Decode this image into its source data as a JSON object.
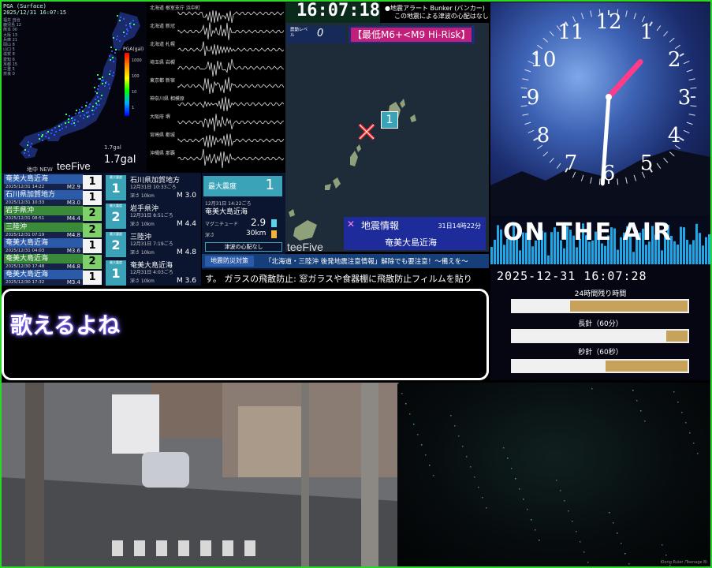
{
  "pga_panel": {
    "title": "PGA (Surface)",
    "datetime": "2025/12/31 16:07:15",
    "prefectures": [
      "福井 自治",
      "鹿児島 12",
      "熊本 00",
      "大阪 13",
      "兵庫 21",
      "岡山 8",
      "山口 5",
      "滋賀 8",
      "愛知 6",
      "京都 15",
      "三重 5",
      "奈良 0"
    ],
    "scale_title": "PGA(gal)",
    "scale_ticks": [
      "1000",
      "100",
      "10",
      "1"
    ],
    "gal_label": "1.7gal",
    "gal_prefix": "1.7gal",
    "footer_left": "地中 NEW",
    "logo": "teeFive"
  },
  "waveforms": {
    "stations": [
      "北海道 根室支庁 浜中町",
      "北海道 新冠",
      "北海道 札幌",
      "埼玉県 岩槻",
      "東京都 新宿",
      "神奈川県 相模原",
      "大阪府 堺",
      "宮崎県 都城",
      "沖縄県 那覇"
    ]
  },
  "quake_list": [
    {
      "loc": "奄美大島近海",
      "time": "2025/12/31 14:22",
      "mag": "M2.9",
      "int": "1",
      "color": "#f4f4f4"
    },
    {
      "loc": "石川県加賀地方",
      "time": "2025/12/31 10:33",
      "mag": "M3.0",
      "int": "1",
      "color": "#f4f4f4"
    },
    {
      "loc": "岩手県沖",
      "time": "2025/12/31 08:51",
      "mag": "M4.4",
      "int": "2",
      "color": "#7fd06a"
    },
    {
      "loc": "三陸沖",
      "time": "2025/12/31 07:19",
      "mag": "M4.8",
      "int": "2",
      "color": "#7fd06a"
    },
    {
      "loc": "奄美大島近海",
      "time": "2025/12/31 04:03",
      "mag": "M3.6",
      "int": "1",
      "color": "#f4f4f4"
    },
    {
      "loc": "奄美大島近海",
      "time": "2025/12/30 17:48",
      "mag": "M4.8",
      "int": "2",
      "color": "#7fd06a"
    },
    {
      "loc": "奄美大島近海",
      "time": "2025/12/30 17:32",
      "mag": "M3.4",
      "int": "1",
      "color": "#f4f4f4"
    }
  ],
  "quake_detail": [
    {
      "badge_label": "最大震度",
      "int": "1",
      "name": "石川県加賀地方",
      "time": "12月31日 10:33ごろ",
      "depth": "深さ 10km",
      "mag": "M 3.0"
    },
    {
      "badge_label": "最大震度",
      "int": "2",
      "name": "岩手県沖",
      "time": "12月31日 8:51ごろ",
      "depth": "深さ 10km",
      "mag": "M 4.4"
    },
    {
      "badge_label": "最大震度",
      "int": "2",
      "name": "三陸沖",
      "time": "12月31日 7:19ごろ",
      "depth": "深さ 10km",
      "mag": "M 4.8"
    },
    {
      "badge_label": "最大震度",
      "int": "1",
      "name": "奄美大島近海",
      "time": "12月31日 4:03ごろ",
      "depth": "深さ 10km",
      "mag": "M 3.6"
    }
  ],
  "summary": {
    "max_label": "最大震度",
    "max_val": "1",
    "time": "12月31日 14:22ごろ",
    "place": "奄美大島近海",
    "mag_label": "マグニチュード",
    "mag_val": "2.9",
    "depth_label": "深さ",
    "depth_val": "30km",
    "tsunami": "津波の心配なし",
    "logo": "teeFive"
  },
  "clock_bar": {
    "time": "16:07:18",
    "bunker": "●地震アラート Bunker (バンカー)",
    "safe": "この地震による津波の心配はなし"
  },
  "epi_map": {
    "level_label": "震動レベル",
    "level": "0",
    "risk": "【最低M6+<M9 Hi-Risk】",
    "marker_int": "1",
    "info_title": "地震情報",
    "info_time": "31日14時22分",
    "info_place": "奄美大島近海"
  },
  "ticker1": {
    "label": "地震防災対策",
    "text": "「北海道・三陸沖 後発地震注意情報」解除でも要注意！〜備えを〜"
  },
  "ticker2": {
    "text": "す。 ガラスの飛散防止: 窓ガラスや食器棚に飛散防止フィルムを貼り"
  },
  "lyrics": {
    "text": "歌えるよね"
  },
  "analog_clock": {
    "numbers": [
      "12",
      "1",
      "2",
      "3",
      "4",
      "5",
      "6",
      "7",
      "8",
      "9",
      "10",
      "11"
    ]
  },
  "on_air": {
    "text": "ON THE AIR"
  },
  "countdown": {
    "datetime": "2025-12-31 16:07:28",
    "day_label": "24時間残り時間",
    "minute_label": "長針（60分）",
    "second_label": "秒針（60秒）",
    "day_fill": 0.33,
    "minute_fill": 0.88,
    "second_fill": 0.53
  },
  "camera2": {
    "credit": "Klong Ruler /Teenage Bl"
  },
  "colors": {
    "accent": "#29d92a",
    "panel": "#0b1530",
    "teal": "#3aa3b8",
    "risk": "#c21e7a"
  }
}
